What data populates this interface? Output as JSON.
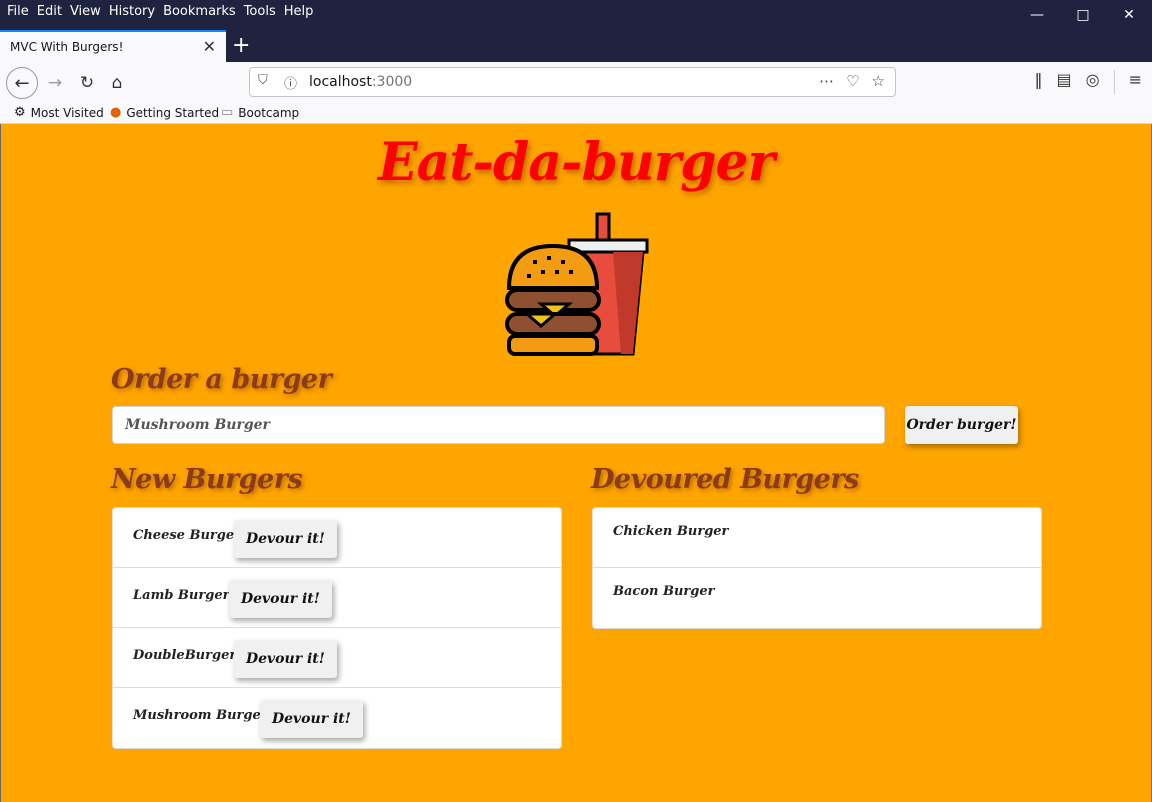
{
  "browser": {
    "menu": [
      "File",
      "Edit",
      "View",
      "History",
      "Bookmarks",
      "Tools",
      "Help"
    ],
    "tab_title": "MVC With Burgers!",
    "url_host": "localhost",
    "url_port": ":3000",
    "bookmarks": [
      {
        "label": "Most Visited",
        "icon": "gear-icon"
      },
      {
        "label": "Getting Started",
        "icon": "firefox-icon"
      },
      {
        "label": "Bootcamp",
        "icon": "folder-icon"
      }
    ]
  },
  "page": {
    "title": "Eat-da-burger",
    "order_heading": "Order a burger",
    "input_placeholder": "Mushroom Burger",
    "order_button": "Order burger!",
    "new_heading": "New Burgers",
    "devoured_heading": "Devoured Burgers",
    "devour_label": "Devour it!",
    "new_burgers": [
      "Cheese Burger",
      "Lamb Burger",
      "DoubleBurger",
      "Mushroom Burger"
    ],
    "devoured_burgers": [
      "Chicken Burger",
      "Bacon Burger"
    ]
  },
  "colors": {
    "page_bg": "#ffa500",
    "title": "#ff0000",
    "heading": "#8b3a1a",
    "chrome_dark": "#202340"
  }
}
